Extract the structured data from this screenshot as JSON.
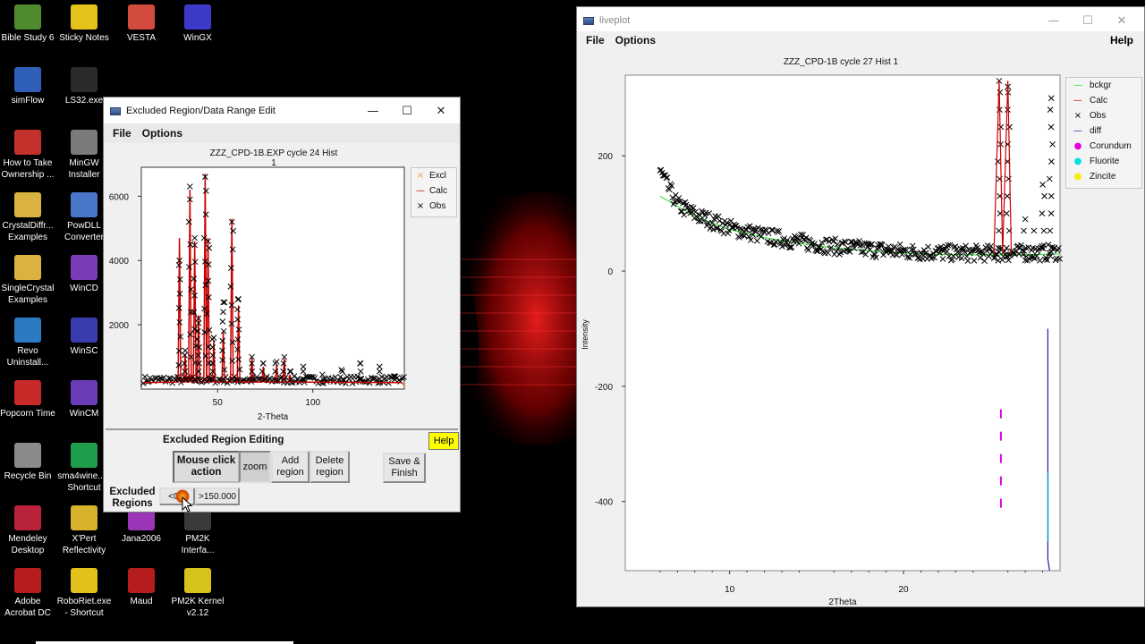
{
  "desktop": {
    "icons": [
      {
        "label": "Bible Study 6",
        "color": "#4e8a2e"
      },
      {
        "label": "Sticky Notes",
        "color": "#e3c21a"
      },
      {
        "label": "VESTA",
        "color": "#d24b3e"
      },
      {
        "label": "WinGX",
        "color": "#3d3ac9"
      },
      {
        "label": "simFlow",
        "color": "#2f5fb8"
      },
      {
        "label": "LS32.exe",
        "color": "#2b2b2b"
      },
      {
        "label": "How to Take Ownership ...",
        "color": "#c4302b"
      },
      {
        "label": "MinGW Installer",
        "color": "#7b7b7b"
      },
      {
        "label": "CrystalDiffr... Examples",
        "color": "#d9b23f"
      },
      {
        "label": "PowDLL Converter",
        "color": "#4a77c9"
      },
      {
        "label": "SingleCrystal Examples",
        "color": "#d9b23f"
      },
      {
        "label": "WinCD",
        "color": "#7a3cb8"
      },
      {
        "label": "Revo Uninstall...",
        "color": "#2c7ac2"
      },
      {
        "label": "WinSC",
        "color": "#3b3bb0"
      },
      {
        "label": "Popcorn Time",
        "color": "#c82a2a"
      },
      {
        "label": "WinCM",
        "color": "#6b3cb8"
      },
      {
        "label": "Recycle Bin",
        "color": "#8a8a8a"
      },
      {
        "label": "sma4wine... - Shortcut",
        "color": "#1e9e4a"
      },
      {
        "label": "Mendeley Desktop",
        "color": "#b8223a"
      },
      {
        "label": "X'Pert Reflectivity",
        "color": "#d6b32a"
      },
      {
        "label": "Jana2006",
        "color": "#9b36b8"
      },
      {
        "label": "PM2K Interfa...",
        "color": "#3a3a3a"
      },
      {
        "label": "Adobe Acrobat DC",
        "color": "#b51d1d"
      },
      {
        "label": "RoboRiet.exe - Shortcut",
        "color": "#e0c21a"
      },
      {
        "label": "Maud",
        "color": "#b51d1d"
      },
      {
        "label": "PM2K Kernel v2.12",
        "color": "#d6c21a"
      }
    ]
  },
  "exclude_window": {
    "title": "Excluded Region/Data Range Edit",
    "menu": {
      "file": "File",
      "options": "Options"
    },
    "plot_title": "ZZZ_CPD-1B.EXP cycle 24 Hist 1",
    "legend": [
      {
        "symbol": "×",
        "label": "Excl",
        "color": "#f0a040"
      },
      {
        "symbol": "—",
        "label": "Calc",
        "color": "#cc0000"
      },
      {
        "symbol": "×",
        "label": "Obs",
        "color": "#000000"
      }
    ],
    "editing_title": "Excluded Region Editing",
    "help": "Help",
    "mouse_label": "Mouse click action",
    "zoom": "zoom",
    "add_region": "Add region",
    "delete_region": "Delete region",
    "save_finish": "Save & Finish",
    "excluded_regions_label": "Excluded Regions",
    "region_low": "<0.0",
    "region_high": ">150.000"
  },
  "liveplot_window": {
    "title": "liveplot",
    "menu": {
      "file": "File",
      "options": "Options",
      "help": "Help"
    },
    "plot_title": "ZZZ_CPD-1B cycle 27 Hist 1",
    "legend": [
      {
        "symbol": "—",
        "label": "bckgr",
        "color": "#22dd22"
      },
      {
        "symbol": "—",
        "label": "Calc",
        "color": "#cc0000"
      },
      {
        "symbol": "×",
        "label": "Obs",
        "color": "#000000"
      },
      {
        "symbol": "—",
        "label": "diff",
        "color": "#2020aa"
      },
      {
        "symbol": "●",
        "label": "Corundum",
        "color": "#e000e0"
      },
      {
        "symbol": "●",
        "label": "Fluorite",
        "color": "#00e0e0"
      },
      {
        "symbol": "●",
        "label": "Zincite",
        "color": "#f0f000"
      }
    ]
  },
  "chart_data": [
    {
      "type": "line",
      "title": "ZZZ_CPD-1B.EXP cycle 24 Hist 1",
      "xlabel": "2-Theta",
      "ylabel": "",
      "xlim": [
        10,
        148
      ],
      "ylim": [
        0,
        6900
      ],
      "x_ticks": [
        50,
        100
      ],
      "y_ticks": [
        2000,
        4000,
        6000
      ],
      "grid": false,
      "legend_position": "right",
      "series": [
        {
          "name": "Calc",
          "x": [
            30,
            33,
            35.5,
            38,
            40,
            43.5,
            45,
            48,
            53,
            57.5,
            61,
            68,
            74,
            81,
            85,
            88
          ],
          "values": [
            4700,
            1100,
            6200,
            4600,
            2300,
            6700,
            4700,
            1500,
            1800,
            5300,
            2600,
            1000,
            700,
            750,
            950,
            450
          ]
        },
        {
          "name": "Obs",
          "x": [
            30,
            33,
            35.5,
            38,
            40,
            43.5,
            45,
            48,
            53,
            57.5,
            61,
            68,
            74,
            81,
            85,
            88,
            95,
            105,
            115,
            125,
            135,
            143
          ],
          "values": [
            4000,
            1200,
            6300,
            4700,
            2200,
            6600,
            4600,
            1600,
            2700,
            5200,
            2800,
            1000,
            800,
            850,
            1000,
            550,
            700,
            450,
            600,
            800,
            700,
            400
          ]
        }
      ]
    },
    {
      "type": "line",
      "title": "ZZZ_CPD-1B cycle 27 Hist 1",
      "xlabel": "2Theta",
      "ylabel": "Intensity",
      "xlim": [
        4,
        29
      ],
      "ylim": [
        -520,
        340
      ],
      "x_ticks": [
        10,
        20
      ],
      "y_ticks": [
        -400,
        -200,
        0,
        200
      ],
      "grid": false,
      "legend_position": "right",
      "series": [
        {
          "name": "bckgr",
          "x": [
            6,
            8,
            10,
            12,
            14,
            16,
            18,
            20,
            22,
            24,
            26,
            28,
            29
          ],
          "values": [
            130,
            95,
            72,
            58,
            48,
            40,
            35,
            31,
            29,
            28,
            28,
            29,
            30
          ]
        },
        {
          "name": "Obs",
          "x": [
            6,
            7,
            8,
            9,
            10,
            12,
            14,
            16,
            18,
            20,
            22,
            24,
            25,
            25.5,
            26,
            27,
            27.5,
            28,
            28.5,
            29
          ],
          "values": [
            180,
            150,
            110,
            95,
            80,
            60,
            50,
            42,
            38,
            35,
            32,
            30,
            45,
            330,
            320,
            90,
            70,
            150,
            300,
            40
          ]
        },
        {
          "name": "Calc",
          "x": [
            25.2,
            25.5,
            25.7,
            26.0,
            26.2
          ],
          "values": [
            30,
            330,
            30,
            330,
            30
          ]
        },
        {
          "name": "Corundum",
          "x": [
            25.6
          ],
          "values": [
            -330
          ]
        },
        {
          "name": "diff",
          "x": [
            28.3,
            28.3,
            28.4
          ],
          "values": [
            -100,
            -520,
            -520
          ]
        }
      ]
    }
  ]
}
